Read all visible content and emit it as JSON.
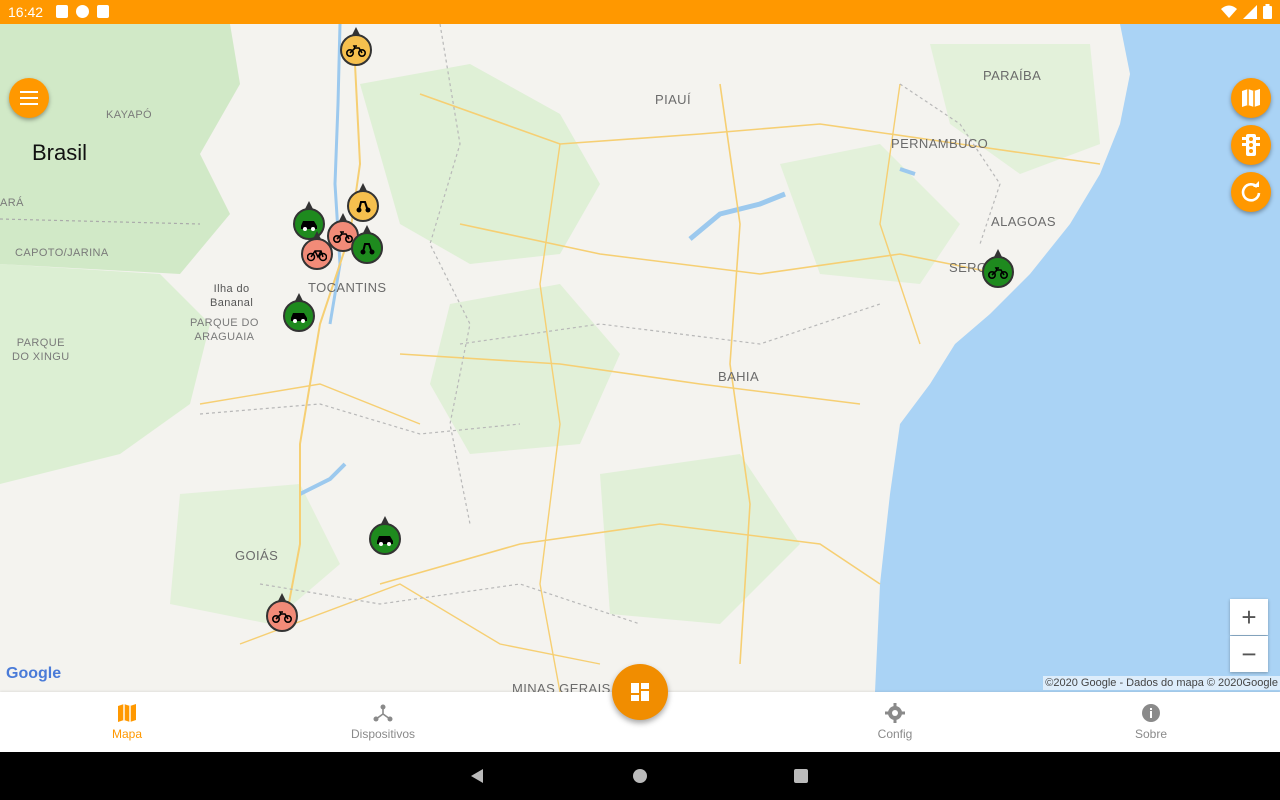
{
  "status_bar": {
    "time": "16:42",
    "icons": [
      "notification-a-icon",
      "notification-b-icon",
      "sd-card-icon"
    ],
    "right_icons": [
      "wifi-icon",
      "signal-icon",
      "battery-icon"
    ]
  },
  "map": {
    "labels": {
      "country": "Brasil",
      "kayapo": "KAYAPÓ",
      "ara": "ARÁ",
      "capoto": "CAPOTO/JARINA",
      "ilha_line1": "Ilha do",
      "ilha_line2": "Bananal",
      "parque_bananal_line1": "PARQUE DO",
      "parque_bananal_line2": "ARAGUAIA",
      "parque_xingu_line1": "PARQUE",
      "parque_xingu_line2": "DO XINGU",
      "tocantins": "TOCANTINS",
      "piaui": "PIAUÍ",
      "paraiba": "PARAÍBA",
      "pernambuco": "PERNAMBUCO",
      "alagoas": "ALAGOAS",
      "sergipe": "SERG",
      "bahia": "BAHIA",
      "goias": "GOIÁS",
      "minas": "MINAS GERAIS"
    },
    "markers": [
      {
        "status": "yellow",
        "vehicle": "motorcycle-icon"
      },
      {
        "status": "yellow",
        "vehicle": "scooter-icon"
      },
      {
        "status": "green",
        "vehicle": "car-icon"
      },
      {
        "status": "salmon",
        "vehicle": "motorcycle-icon"
      },
      {
        "status": "salmon",
        "vehicle": "bicycle-icon"
      },
      {
        "status": "green",
        "vehicle": "scooter-icon"
      },
      {
        "status": "green",
        "vehicle": "car-icon"
      },
      {
        "status": "green",
        "vehicle": "motorcycle-icon"
      },
      {
        "status": "green",
        "vehicle": "car-icon"
      },
      {
        "status": "salmon",
        "vehicle": "motorcycle-icon"
      }
    ],
    "zoom_in": "+",
    "zoom_out": "−",
    "google_logo": "Google",
    "attribution": "©2020 Google - Dados do mapa © 2020Google",
    "colors": {
      "water": "#aad3f5",
      "land": "#f4f3ef",
      "vegetation": "#cde8c2",
      "roads": "#f7d27a",
      "accent": "#ff9800"
    }
  },
  "side_buttons": [
    "map-layers-icon",
    "traffic-light-icon",
    "refresh-icon"
  ],
  "bottom_nav": {
    "items": [
      {
        "label": "Mapa",
        "icon": "map-icon",
        "active": true
      },
      {
        "label": "Dispositivos",
        "icon": "devices-icon",
        "active": false
      },
      {
        "label": "Config",
        "icon": "gear-icon",
        "active": false
      },
      {
        "label": "Sobre",
        "icon": "info-icon",
        "active": false
      }
    ],
    "center_button": "dashboard-icon"
  },
  "system_nav": [
    "back-icon",
    "home-icon",
    "recents-icon"
  ]
}
